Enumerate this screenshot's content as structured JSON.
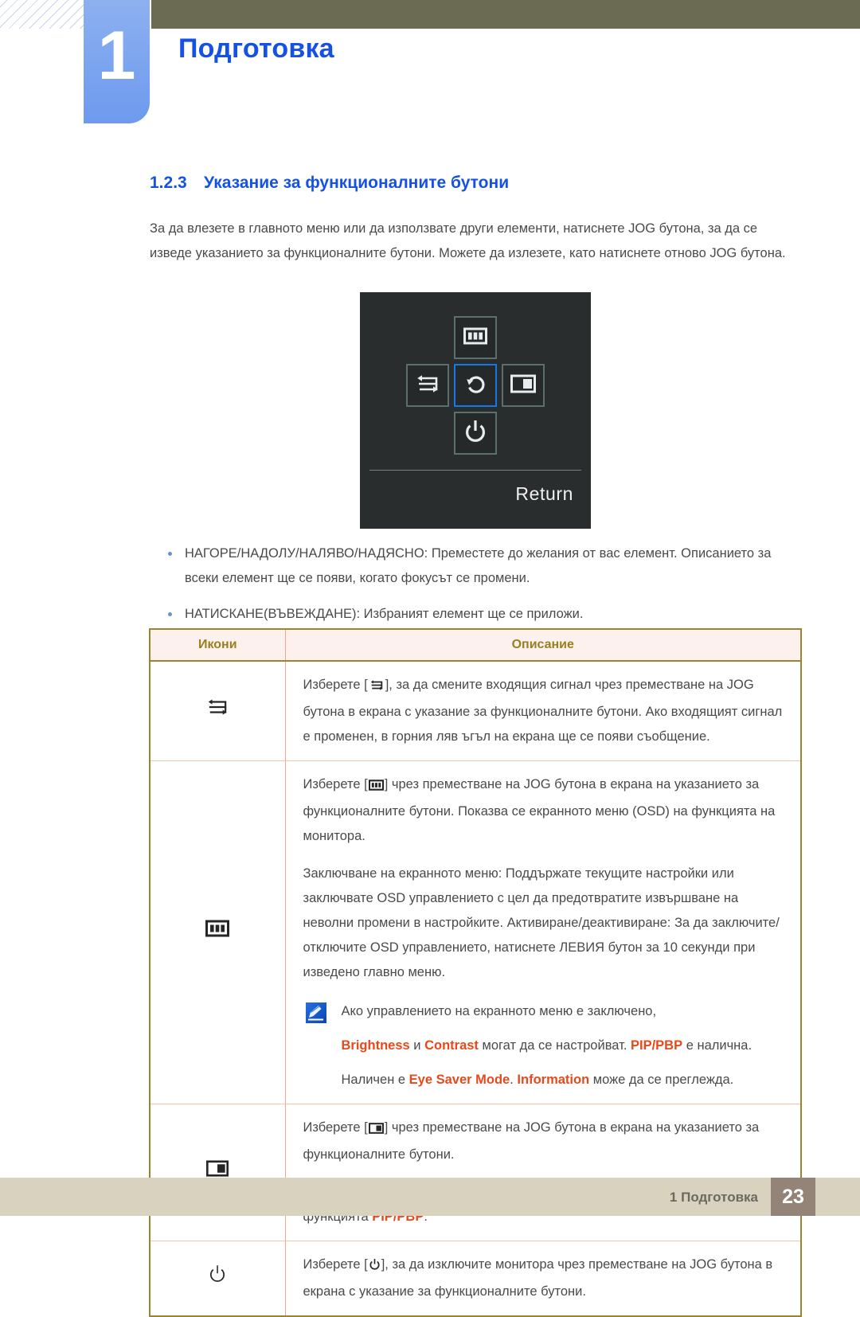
{
  "header": {
    "chapter_number": "1",
    "chapter_title": "Подготовка"
  },
  "section": {
    "number": "1.2.3",
    "title": "Указание за функционалните бутони",
    "intro": "За да влезете в главното меню или да използвате други елементи, натиснете JOG бутона, за да се изведе указанието за функционалните бутони. Можете да излезете, като натиснете отново JOG бутона."
  },
  "osd": {
    "return_label": "Return",
    "keys": [
      {
        "position": "up",
        "icon": "osd-menu-icon",
        "selected": false
      },
      {
        "position": "left",
        "icon": "source-switch-icon",
        "selected": false
      },
      {
        "position": "center",
        "icon": "return-icon",
        "selected": true
      },
      {
        "position": "right",
        "icon": "pip-pbp-icon",
        "selected": false
      },
      {
        "position": "down",
        "icon": "power-icon",
        "selected": false
      }
    ],
    "selected_border_color": "#1478e8",
    "background_color": "#2a2d2d"
  },
  "bullets": [
    "НАГОРЕ/НАДОЛУ/НАЛЯВО/НАДЯСНО: Преместете до желания от вас елемент. Описанието за всеки елемент ще се появи, когато фокусът се промени.",
    "НАТИСКАНЕ(ВЪВЕЖДАНЕ): Избраният елемент ще се приложи."
  ],
  "table": {
    "headers": {
      "icons": "Икони",
      "description": "Описание"
    },
    "rows": [
      {
        "icon": "source-switch-icon",
        "paragraphs": [
          {
            "pre": "Изберете [",
            "icon": "source-switch-icon",
            "post": "], за да смените входящия сигнал чрез преместване на JOG бутона в екрана с указание за функционалните бутони. Ако входящият сигнал е променен, в горния ляв ъгъл на екрана ще се появи съобщение."
          }
        ]
      },
      {
        "icon": "osd-menu-icon",
        "paragraphs": [
          {
            "pre": "Изберете [",
            "icon": "osd-menu-icon",
            "post": "] чрез преместване на JOG бутона в екрана на указанието за функционалните бутони. Показва се екранното меню (OSD) на функцията на монитора."
          },
          {
            "pre": "",
            "icon": null,
            "post": "Заключване на екранното меню: Поддържате текущите настройки или заключвате OSD управлението с цел да предотвратите извършване на неволни промени в настройките. Активиране/деактивиране: За да заключите/отключите OSD управлението, натиснете ЛЕВИЯ бутон за 10 секунди при изведено главно меню."
          }
        ],
        "note": {
          "icon": "note-pen-icon",
          "lines": [
            [
              {
                "text": "Ако управлението на екранното меню е заключено,",
                "highlight": false
              }
            ],
            [
              {
                "text": "Brightness",
                "highlight": true
              },
              {
                "text": " и ",
                "highlight": false
              },
              {
                "text": "Contrast",
                "highlight": true
              },
              {
                "text": " могат да се настройват. ",
                "highlight": false
              },
              {
                "text": "PIP/PBP",
                "highlight": true
              },
              {
                "text": " е налична.",
                "highlight": false
              }
            ],
            [
              {
                "text": "Наличен е ",
                "highlight": false
              },
              {
                "text": "Eye Saver Mode",
                "highlight": true
              },
              {
                "text": ". ",
                "highlight": false
              },
              {
                "text": "Information",
                "highlight": true
              },
              {
                "text": " може да се преглежда.",
                "highlight": false
              }
            ]
          ]
        }
      },
      {
        "icon": "pip-pbp-icon",
        "paragraphs": [
          {
            "pre": "Изберете [",
            "icon": "pip-pbp-icon",
            "post": "] чрез преместване на JOG бутона в екрана на указанието за функционалните бутони."
          },
          {
            "pre": "",
            "icon": null,
            "post": "Натиснете бутона, когато се налага да се конфигурират настройките за функцията ",
            "highlight_suffix": "PIP/PBP",
            "tail": "."
          }
        ]
      },
      {
        "icon": "power-icon",
        "paragraphs": [
          {
            "pre": "Изберете [",
            "icon": "power-icon",
            "post": "], за да изключите монитора чрез преместване на JOG бутона в екрана с указание за функционалните бутони."
          }
        ]
      }
    ]
  },
  "footer": {
    "text": "1 Подготовка",
    "page_number": "23"
  },
  "colors": {
    "accent_blue": "#1551e5",
    "header_olive": "#6b6a53",
    "tab_blue": "#7ba4ef",
    "table_border": "#9a8430",
    "table_header_bg": "#fdf1ee",
    "highlight_orange": "#e8491b",
    "footer_bg": "#d9d2bf",
    "page_badge_bg": "#938477"
  }
}
